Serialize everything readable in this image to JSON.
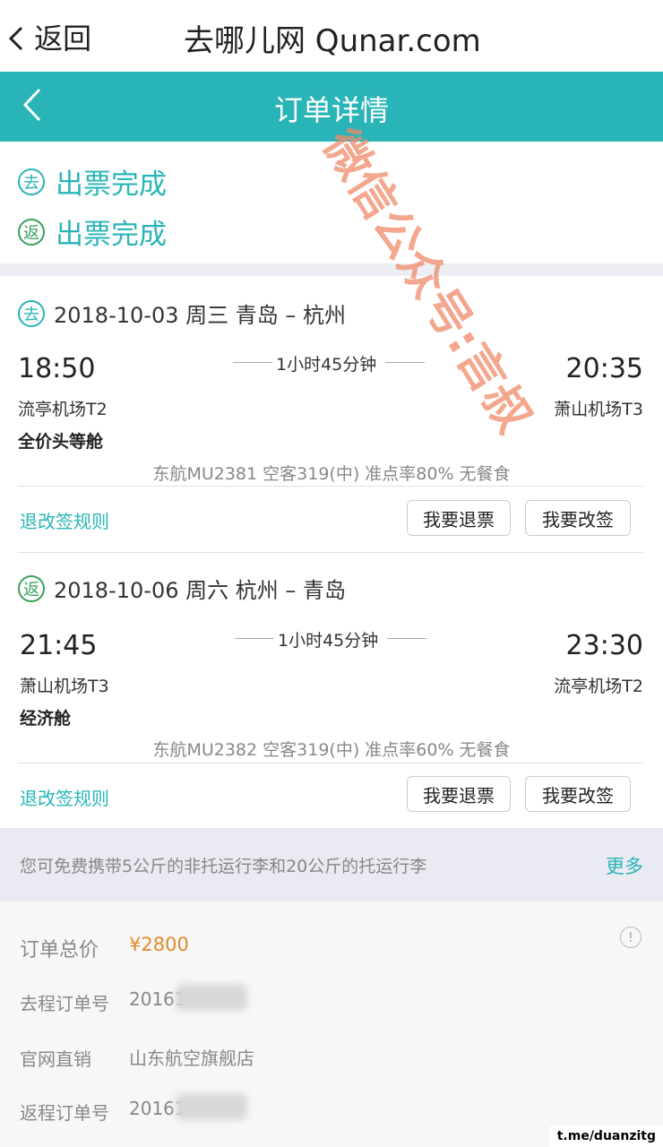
{
  "top_bar": {
    "back_label": "返回",
    "site_title": "去哪儿网 Qunar.com"
  },
  "nav": {
    "title": "订单详情"
  },
  "status": {
    "outbound_badge": "去",
    "outbound_text": "出票完成",
    "return_badge": "返",
    "return_text": "出票完成"
  },
  "legs": [
    {
      "badge": "去",
      "header": "2018-10-03 周三 青岛 – 杭州",
      "depart_time": "18:50",
      "arrive_time": "20:35",
      "duration": "1小时45分钟",
      "depart_airport": "流亭机场T2",
      "arrive_airport": "萧山机场T3",
      "cabin": "全价头等舱",
      "flight_info": "东航MU2381 空客319(中) 准点率80% 无餐食",
      "rules_link": "退改签规则",
      "refund_button": "我要退票",
      "change_button": "我要改签"
    },
    {
      "badge": "返",
      "header": "2018-10-06 周六 杭州 – 青岛",
      "depart_time": "21:45",
      "arrive_time": "23:30",
      "duration": "1小时45分钟",
      "depart_airport": "萧山机场T3",
      "arrive_airport": "流亭机场T2",
      "cabin": "经济舱",
      "flight_info": "东航MU2382 空客319(中) 准点率60% 无餐食",
      "rules_link": "退改签规则",
      "refund_button": "我要退票",
      "change_button": "我要改签"
    }
  ],
  "baggage": {
    "text": "您可免费携带5公斤的非托运行李和20公斤的托运行李",
    "more": "更多"
  },
  "order": {
    "total_label": "订单总价",
    "total_value": "¥2800",
    "outbound_no_label": "去程订单号",
    "outbound_no_value": "20161",
    "channel_label": "官网直销",
    "channel_value": "山东航空旗舰店",
    "return_no_label": "返程订单号",
    "return_no_value": "20161"
  },
  "watermark_text": "微信公众号:言叔",
  "corner_tag": "t.me/duanzitg",
  "colors": {
    "accent": "#29b5b7",
    "return_green": "#3aa05a",
    "price": "#e08a2a",
    "watermark": "#f08a6a"
  }
}
